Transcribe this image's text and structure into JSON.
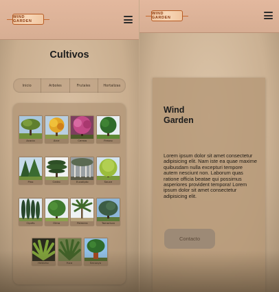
{
  "header": {
    "logo_text": "WIND GARDEN",
    "menu_icon": "hamburger-menu-icon"
  },
  "page": {
    "title": "Cultivos",
    "tabs": [
      {
        "label": "Inicio"
      },
      {
        "label": "Arboles"
      },
      {
        "label": "Frutales"
      },
      {
        "label": "Hortalizas"
      }
    ]
  },
  "gallery": {
    "rows": [
      [
        {
          "label": "Acacia"
        },
        {
          "label": "Arce"
        },
        {
          "label": "Cerezo"
        },
        {
          "label": "Fresno"
        }
      ],
      [
        {
          "label": "Pino"
        },
        {
          "label": "Cedro"
        },
        {
          "label": "Eucalipto"
        },
        {
          "label": "Sauce"
        }
      ],
      [
        {
          "label": "Ciprés"
        },
        {
          "label": "Olmo"
        },
        {
          "label": "Palmera"
        },
        {
          "label": "Tamarisco"
        }
      ],
      [
        {
          "label": "Helecho"
        },
        {
          "label": "Yuca"
        },
        {
          "label": "Secuoya"
        }
      ]
    ]
  },
  "card": {
    "title": "Wind\nGarden",
    "text": "Lorem ipsum dolor sit amet consectetur adipisicing elit. Nam iste ea quae maxime quibusdam nulla excepturi tempore autem nesciunt non. Laborum quas ratione officia beatae qui possimus asperiores provident tempora! Lorem ipsum dolor sit amet consectetur adipisicing elit.",
    "button_label": "Contacto"
  },
  "colors": {
    "header_bg": "#e3b89e",
    "logo_accent": "#b65a22",
    "button_bg": "#9d8a76"
  }
}
